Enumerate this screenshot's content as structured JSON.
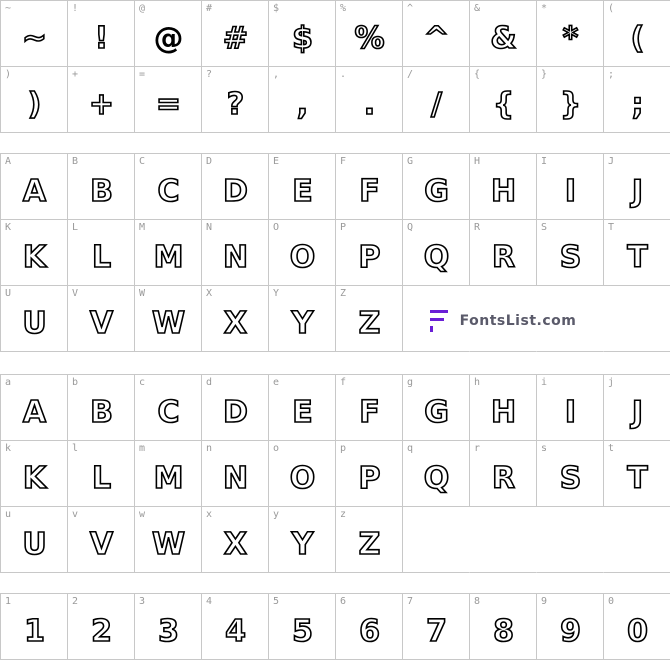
{
  "sections": {
    "symbols": {
      "cells": [
        {
          "cap": "~",
          "glyph": "~"
        },
        {
          "cap": "!",
          "glyph": "!"
        },
        {
          "cap": "@",
          "glyph": "@"
        },
        {
          "cap": "#",
          "glyph": "#"
        },
        {
          "cap": "$",
          "glyph": "$"
        },
        {
          "cap": "%",
          "glyph": "%"
        },
        {
          "cap": "^",
          "glyph": "^"
        },
        {
          "cap": "&",
          "glyph": "&"
        },
        {
          "cap": "*",
          "glyph": "*"
        },
        {
          "cap": "(",
          "glyph": "("
        },
        {
          "cap": ")",
          "glyph": ")"
        },
        {
          "cap": "+",
          "glyph": "+"
        },
        {
          "cap": "=",
          "glyph": "="
        },
        {
          "cap": "?",
          "glyph": "?"
        },
        {
          "cap": ",",
          "glyph": ","
        },
        {
          "cap": ".",
          "glyph": "."
        },
        {
          "cap": "/",
          "glyph": "/"
        },
        {
          "cap": "{",
          "glyph": "{"
        },
        {
          "cap": "}",
          "glyph": "}"
        },
        {
          "cap": ";",
          "glyph": ";"
        }
      ]
    },
    "uppercase": {
      "cells": [
        {
          "cap": "A",
          "glyph": "A"
        },
        {
          "cap": "B",
          "glyph": "B"
        },
        {
          "cap": "C",
          "glyph": "C"
        },
        {
          "cap": "D",
          "glyph": "D"
        },
        {
          "cap": "E",
          "glyph": "E"
        },
        {
          "cap": "F",
          "glyph": "F"
        },
        {
          "cap": "G",
          "glyph": "G"
        },
        {
          "cap": "H",
          "glyph": "H"
        },
        {
          "cap": "I",
          "glyph": "I"
        },
        {
          "cap": "J",
          "glyph": "J"
        },
        {
          "cap": "K",
          "glyph": "K"
        },
        {
          "cap": "L",
          "glyph": "L"
        },
        {
          "cap": "M",
          "glyph": "M"
        },
        {
          "cap": "N",
          "glyph": "N"
        },
        {
          "cap": "O",
          "glyph": "O"
        },
        {
          "cap": "P",
          "glyph": "P"
        },
        {
          "cap": "Q",
          "glyph": "Q"
        },
        {
          "cap": "R",
          "glyph": "R"
        },
        {
          "cap": "S",
          "glyph": "S"
        },
        {
          "cap": "T",
          "glyph": "T"
        },
        {
          "cap": "U",
          "glyph": "U"
        },
        {
          "cap": "V",
          "glyph": "V"
        },
        {
          "cap": "W",
          "glyph": "W"
        },
        {
          "cap": "X",
          "glyph": "X"
        },
        {
          "cap": "Y",
          "glyph": "Y"
        },
        {
          "cap": "Z",
          "glyph": "Z"
        }
      ],
      "logo_text": "FontsList.com",
      "logo_color": "#6a1fd6"
    },
    "lowercase": {
      "cells": [
        {
          "cap": "a",
          "glyph": "A"
        },
        {
          "cap": "b",
          "glyph": "B"
        },
        {
          "cap": "c",
          "glyph": "C"
        },
        {
          "cap": "d",
          "glyph": "D"
        },
        {
          "cap": "e",
          "glyph": "E"
        },
        {
          "cap": "f",
          "glyph": "F"
        },
        {
          "cap": "g",
          "glyph": "G"
        },
        {
          "cap": "h",
          "glyph": "H"
        },
        {
          "cap": "i",
          "glyph": "I"
        },
        {
          "cap": "j",
          "glyph": "J"
        },
        {
          "cap": "k",
          "glyph": "K"
        },
        {
          "cap": "l",
          "glyph": "L"
        },
        {
          "cap": "m",
          "glyph": "M"
        },
        {
          "cap": "n",
          "glyph": "N"
        },
        {
          "cap": "o",
          "glyph": "O"
        },
        {
          "cap": "p",
          "glyph": "P"
        },
        {
          "cap": "q",
          "glyph": "Q"
        },
        {
          "cap": "r",
          "glyph": "R"
        },
        {
          "cap": "s",
          "glyph": "S"
        },
        {
          "cap": "t",
          "glyph": "T"
        },
        {
          "cap": "u",
          "glyph": "U"
        },
        {
          "cap": "v",
          "glyph": "V"
        },
        {
          "cap": "w",
          "glyph": "W"
        },
        {
          "cap": "x",
          "glyph": "X"
        },
        {
          "cap": "y",
          "glyph": "Y"
        },
        {
          "cap": "z",
          "glyph": "Z"
        }
      ]
    },
    "digits": {
      "cells": [
        {
          "cap": "1",
          "glyph": "1"
        },
        {
          "cap": "2",
          "glyph": "2"
        },
        {
          "cap": "3",
          "glyph": "3"
        },
        {
          "cap": "4",
          "glyph": "4"
        },
        {
          "cap": "5",
          "glyph": "5"
        },
        {
          "cap": "6",
          "glyph": "6"
        },
        {
          "cap": "7",
          "glyph": "7"
        },
        {
          "cap": "8",
          "glyph": "8"
        },
        {
          "cap": "9",
          "glyph": "9"
        },
        {
          "cap": "0",
          "glyph": "0"
        }
      ]
    }
  }
}
